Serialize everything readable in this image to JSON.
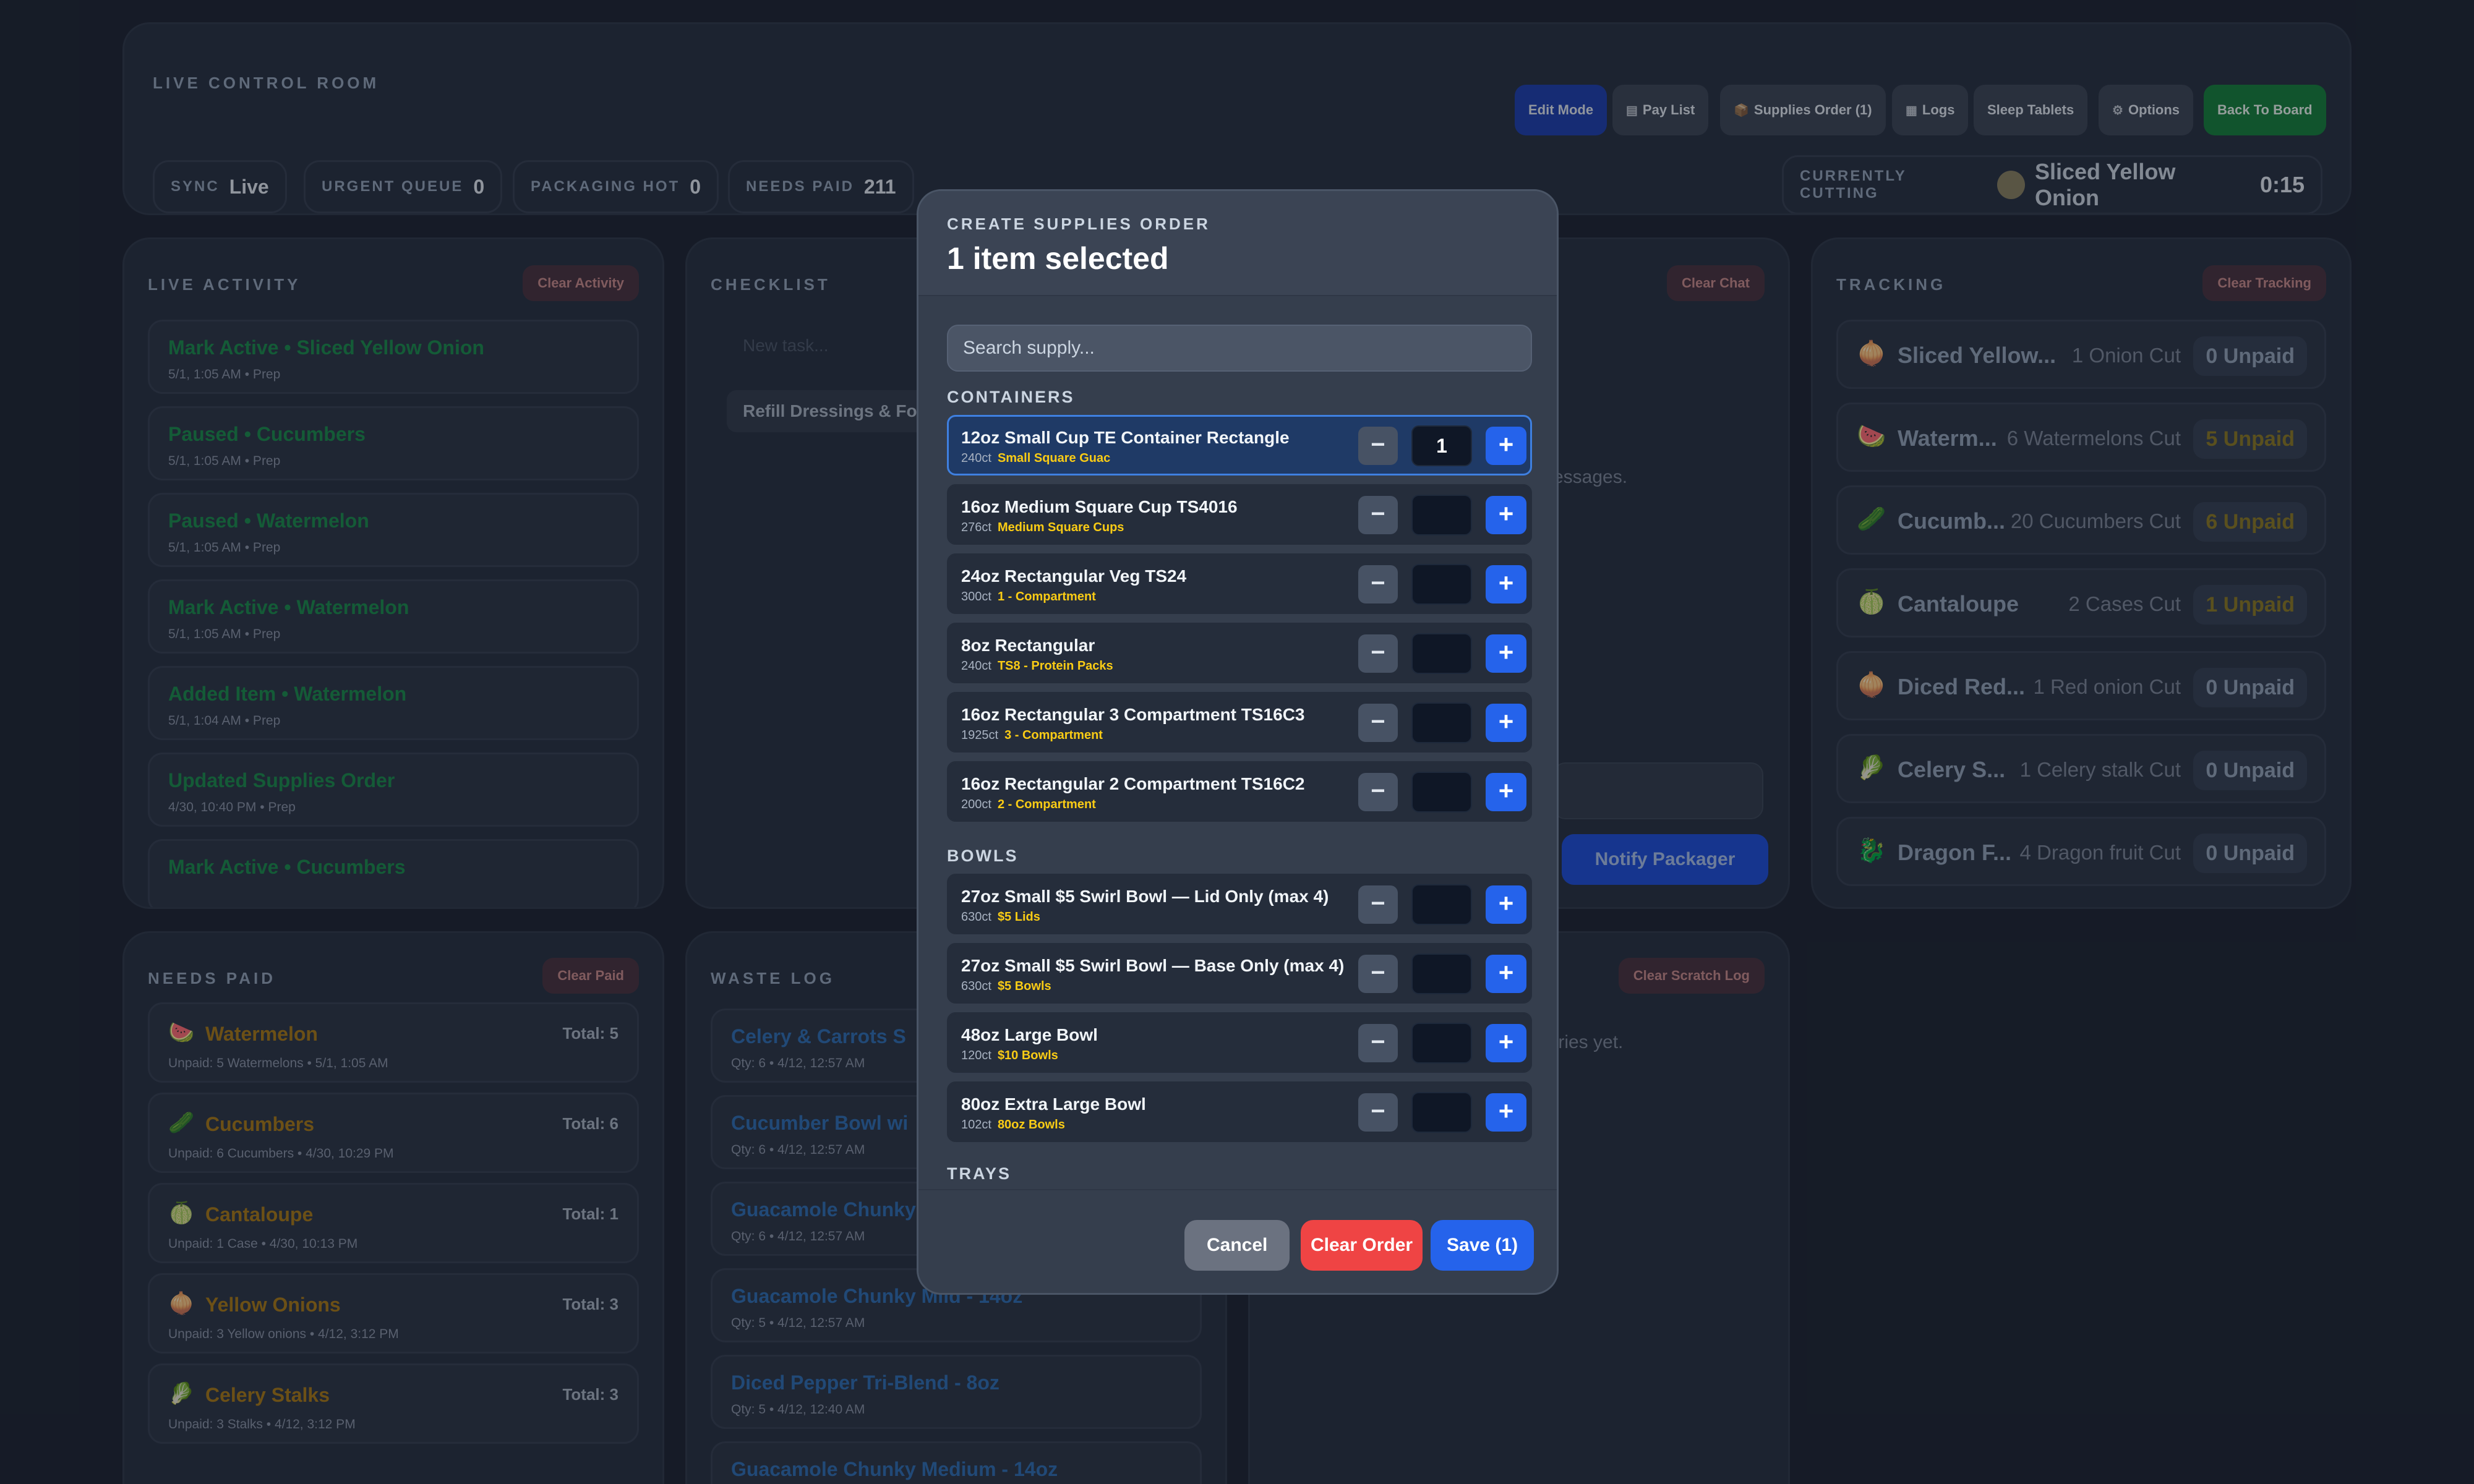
{
  "header": {
    "title": "LIVE CONTROL ROOM",
    "buttons": {
      "edit_mode": "Edit Mode",
      "pay_list": "Pay List",
      "supplies_order": "Supplies Order (1)",
      "logs": "Logs",
      "sleep_tablets": "Sleep Tablets",
      "options": "Options",
      "back_to_board": "Back To Board"
    },
    "chips": {
      "sync": {
        "label": "SYNC",
        "value": "Live"
      },
      "urgent": {
        "label": "URGENT QUEUE",
        "value": "0"
      },
      "packaging": {
        "label": "PACKAGING HOT",
        "value": "0"
      },
      "needs_paid": {
        "label": "NEEDS PAID",
        "value": "211"
      }
    },
    "currently_cutting": {
      "label": "CURRENTLY CUTTING",
      "item": "Sliced Yellow Onion",
      "timer": "0:15"
    }
  },
  "live_activity": {
    "title": "LIVE ACTIVITY",
    "clear": "Clear Activity",
    "items": [
      {
        "title": "Mark Active • Sliced Yellow Onion",
        "sub": "5/1, 1:05 AM • Prep"
      },
      {
        "title": "Paused • Cucumbers",
        "sub": "5/1, 1:05 AM • Prep"
      },
      {
        "title": "Paused • Watermelon",
        "sub": "5/1, 1:05 AM • Prep"
      },
      {
        "title": "Mark Active • Watermelon",
        "sub": "5/1, 1:05 AM • Prep"
      },
      {
        "title": "Added Item • Watermelon",
        "sub": "5/1, 1:04 AM • Prep"
      },
      {
        "title": "Updated Supplies Order",
        "sub": "4/30, 10:40 PM • Prep"
      },
      {
        "title": "Mark Active • Cucumbers",
        "sub": ""
      }
    ]
  },
  "checklist": {
    "title": "CHECKLIST",
    "placeholder": "New task...",
    "item": "Refill Dressings & Fo"
  },
  "chat": {
    "clear": "Clear Chat",
    "empty": "essages.",
    "notify": "Notify Packager"
  },
  "tracking": {
    "title": "TRACKING",
    "clear": "Clear Tracking",
    "items": [
      {
        "icon": "🧅",
        "name": "Sliced Yellow...",
        "count": "1 Onion Cut",
        "unpaid": "0 Unpaid"
      },
      {
        "icon": "🍉",
        "name": "Waterm...",
        "count": "6 Watermelons Cut",
        "unpaid": "5 Unpaid"
      },
      {
        "icon": "🥒",
        "name": "Cucumb...",
        "count": "20 Cucumbers Cut",
        "unpaid": "6 Unpaid"
      },
      {
        "icon": "🍈",
        "name": "Cantaloupe",
        "count": "2 Cases Cut",
        "unpaid": "1 Unpaid"
      },
      {
        "icon": "🧅",
        "name": "Diced Red...",
        "count": "1 Red onion Cut",
        "unpaid": "0 Unpaid"
      },
      {
        "icon": "🥬",
        "name": "Celery S...",
        "count": "1 Celery stalk Cut",
        "unpaid": "0 Unpaid"
      },
      {
        "icon": "🐉",
        "name": "Dragon F...",
        "count": "4 Dragon fruit Cut",
        "unpaid": "0 Unpaid"
      }
    ]
  },
  "needs_paid": {
    "title": "NEEDS PAID",
    "clear": "Clear Paid",
    "items": [
      {
        "icon": "🍉",
        "name": "Watermelon",
        "total": "Total: 5",
        "sub": "Unpaid: 5 Watermelons • 5/1, 1:05 AM"
      },
      {
        "icon": "🥒",
        "name": "Cucumbers",
        "total": "Total: 6",
        "sub": "Unpaid: 6 Cucumbers • 4/30, 10:29 PM"
      },
      {
        "icon": "🍈",
        "name": "Cantaloupe",
        "total": "Total: 1",
        "sub": "Unpaid: 1 Case • 4/30, 10:13 PM"
      },
      {
        "icon": "🧅",
        "name": "Yellow Onions",
        "total": "Total: 3",
        "sub": "Unpaid: 3 Yellow onions • 4/12, 3:12 PM"
      },
      {
        "icon": "🥬",
        "name": "Celery Stalks",
        "total": "Total: 3",
        "sub": "Unpaid: 3 Stalks • 4/12, 3:12 PM"
      }
    ]
  },
  "waste_log": {
    "title": "WASTE LOG",
    "items": [
      {
        "title": "Celery & Carrots S",
        "sub": "Qty: 6 • 4/12, 12:57 AM"
      },
      {
        "title": "Cucumber Bowl wi",
        "sub": "Qty: 6 • 4/12, 12:57 AM"
      },
      {
        "title": "Guacamole Chunky",
        "sub": "Qty: 6 • 4/12, 12:57 AM"
      },
      {
        "title": "Guacamole Chunky Mild - 14oz",
        "sub": "Qty: 5 • 4/12, 12:57 AM"
      },
      {
        "title": "Diced Pepper Tri-Blend - 8oz",
        "sub": "Qty: 5 • 4/12, 12:40 AM"
      },
      {
        "title": "Guacamole Chunky Medium - 14oz",
        "sub": ""
      }
    ]
  },
  "scratch_log": {
    "clear": "Clear Scratch Log",
    "empty": "tries yet."
  },
  "modal": {
    "kicker": "CREATE SUPPLIES ORDER",
    "title": "1 item selected",
    "search_placeholder": "Search supply...",
    "sections": {
      "containers": "CONTAINERS",
      "bowls": "BOWLS",
      "trays": "TRAYS"
    },
    "containers": [
      {
        "name": "12oz Small Cup TE Container Rectangle",
        "count": "240ct",
        "tag": "Small Square Guac",
        "qty": "1",
        "selected": true
      },
      {
        "name": "16oz Medium Square Cup TS4016",
        "count": "276ct",
        "tag": "Medium Square Cups",
        "qty": ""
      },
      {
        "name": "24oz Rectangular Veg TS24",
        "count": "300ct",
        "tag": "1 - Compartment",
        "qty": ""
      },
      {
        "name": "8oz Rectangular",
        "count": "240ct",
        "tag": "TS8 - Protein Packs",
        "qty": ""
      },
      {
        "name": "16oz Rectangular 3 Compartment TS16C3",
        "count": "1925ct",
        "tag": "3 - Compartment",
        "qty": ""
      },
      {
        "name": "16oz Rectangular 2 Compartment TS16C2",
        "count": "200ct",
        "tag": "2 - Compartment",
        "qty": ""
      }
    ],
    "bowls": [
      {
        "name": "27oz Small $5 Swirl Bowl — Lid Only (max 4)",
        "count": "630ct",
        "tag": "$5 Lids",
        "qty": ""
      },
      {
        "name": "27oz Small $5 Swirl Bowl — Base Only (max 4)",
        "count": "630ct",
        "tag": "$5 Bowls",
        "qty": ""
      },
      {
        "name": "48oz Large Bowl",
        "count": "120ct",
        "tag": "$10 Bowls",
        "qty": ""
      },
      {
        "name": "80oz Extra Large Bowl",
        "count": "102ct",
        "tag": "80oz Bowls",
        "qty": ""
      }
    ],
    "buttons": {
      "cancel": "Cancel",
      "clear": "Clear Order",
      "save": "Save (1)"
    }
  }
}
